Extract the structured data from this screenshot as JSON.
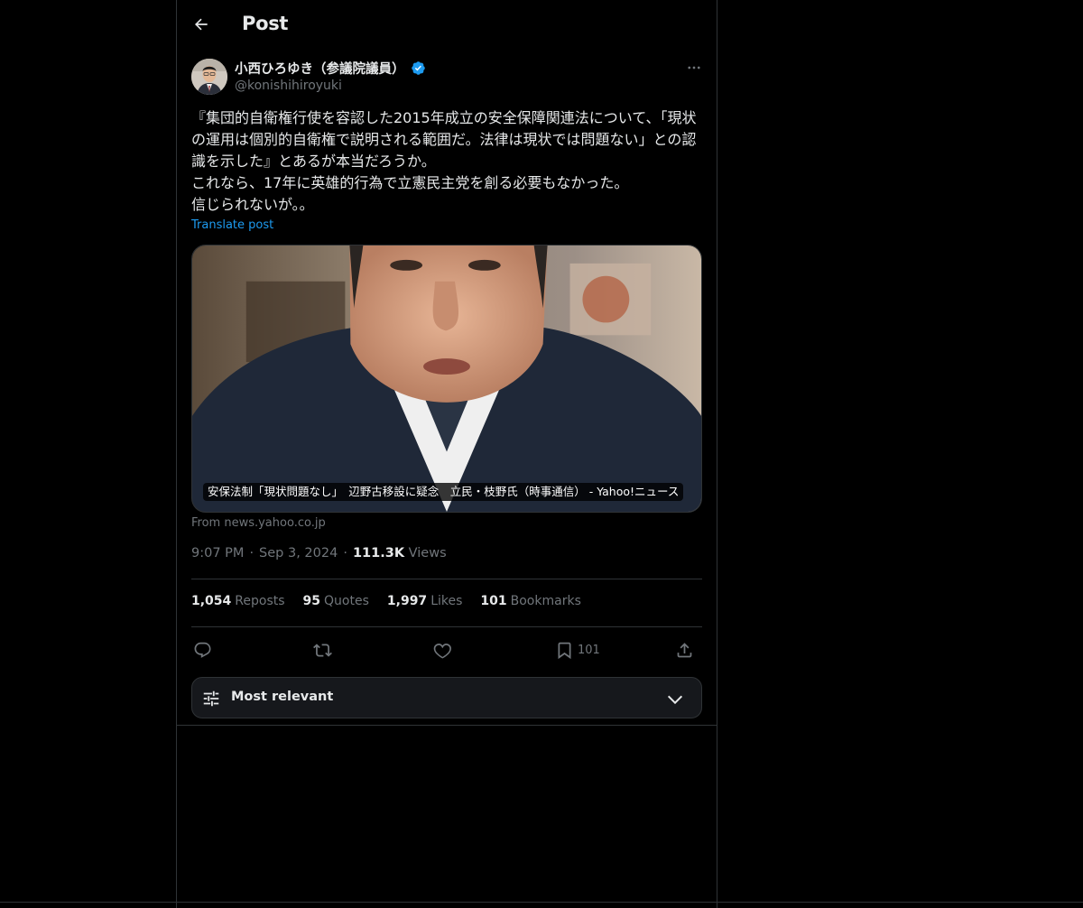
{
  "header": {
    "title": "Post"
  },
  "author": {
    "name": "小西ひろゆき（参議院議員）",
    "handle": "@konishihiroyuki",
    "verified": true
  },
  "post": {
    "text": "『集団的自衛権行使を容認した2015年成立の安全保障関連法について、「現状の運用は個別的自衛権で説明される範囲だ。法律は現状では問題ない」との認識を示した』とあるが本当だろうか。\nこれなら、17年に英雄的行為で立憲民主党を創る必要もなかった。\n信じられないが。。",
    "translate_label": "Translate post",
    "card": {
      "caption": "安保法制「現状問題なし」　辺野古移設に疑念　立民・枝野氏（時事通信） - Yahoo!ニュース",
      "source": "From news.yahoo.co.jp"
    }
  },
  "meta": {
    "time": "9:07 PM",
    "separator": "·",
    "date": "Sep 3, 2024",
    "views_count": "111.3K",
    "views_label": "Views"
  },
  "stats": {
    "reposts": {
      "count": "1,054",
      "label": "Reposts"
    },
    "quotes": {
      "count": "95",
      "label": "Quotes"
    },
    "likes": {
      "count": "1,997",
      "label": "Likes"
    },
    "bookmarks": {
      "count": "101",
      "label": "Bookmarks"
    }
  },
  "actions": {
    "bookmark_count": "101",
    "icons": [
      "reply-icon",
      "repost-icon",
      "like-icon",
      "bookmark-icon",
      "share-icon"
    ]
  },
  "sort": {
    "label": "Most relevant"
  },
  "colors": {
    "background": "#000000",
    "text": "#e7e9ea",
    "muted": "#71767b",
    "accent": "#1d9bf0",
    "border": "#2f3336"
  }
}
